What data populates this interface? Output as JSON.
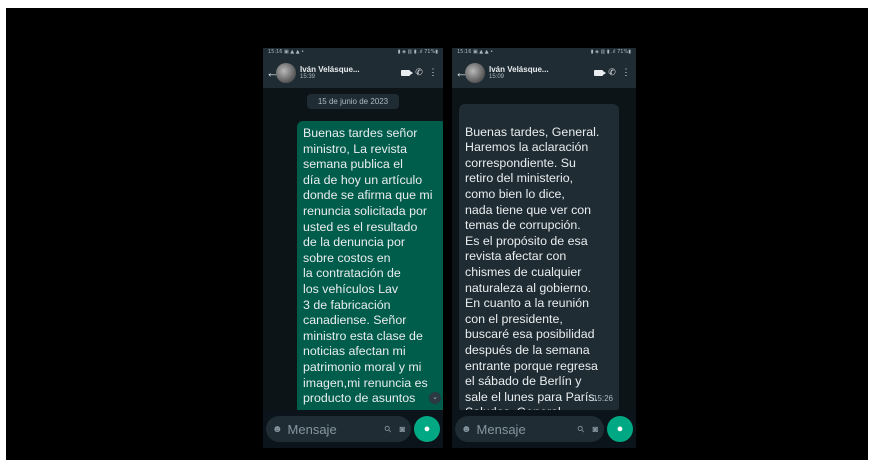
{
  "colors": {
    "outgoing_bubble": "#005c4b",
    "incoming_bubble": "#1f2c34",
    "accent": "#00a884",
    "background": "#0b141a"
  },
  "left_phone": {
    "status_left": "15:16 ▣ ▲ ▲ •",
    "status_right": "▮ ◈ ▥ ▮ .ıl 71%▮",
    "contact_name": "Iván Velásque...",
    "last_seen": "15:39",
    "date_chip": "15 de junio de 2023",
    "message_text": "Buenas tardes señor\nministro, La revista\nsemana publica el\ndía de hoy un artículo\ndonde se afirma que mi\nrenuncia solicitada por\nusted es el resultado\nde la denuncia por\nsobre costos en\nla contratación de\nlos vehículos Lav\n3 de fabricación\ncanadiense. Señor\nministro esta clase de\nnoticias afectan mi\npatrimonio moral y mi\nimagen,mi renuncia es\nproducto de asuntos",
    "input_placeholder": "Mensaje",
    "icons": {
      "back": "back-arrow-icon",
      "video": "video-call-icon",
      "call": "phone-icon",
      "menu": "more-vert-icon",
      "emoji": "emoji-icon",
      "attach": "paperclip-icon",
      "camera": "camera-icon",
      "mic": "mic-icon",
      "scroll": "chevron-down-icon"
    }
  },
  "right_phone": {
    "status_left": "15:16 ▣ ▲ ▲ •",
    "status_right": "▮ ◈ ▥ ▮ .ıl 71%▮",
    "contact_name": "Iván Velásque...",
    "last_seen": "15:09",
    "message_text": "Buenas tardes, General.\nHaremos la aclaración\ncorrespondiente. Su\nretiro del ministerio,\ncomo bien lo dice,\nnada tiene que ver con\ntemas de corrupción.\nEs el propósito de esa\nrevista afectar con\nchismes de cualquier\nnaturaleza al gobierno.\nEn cuanto a la reunión\ncon el presidente,\nbuscaré esa posibilidad\ndespués de la semana\nentrante porque regresa\nel sábado de Berlín y\nsale el lunes para París.\nSaludos, General",
    "message_time": "15:26",
    "input_placeholder": "Mensaje"
  }
}
